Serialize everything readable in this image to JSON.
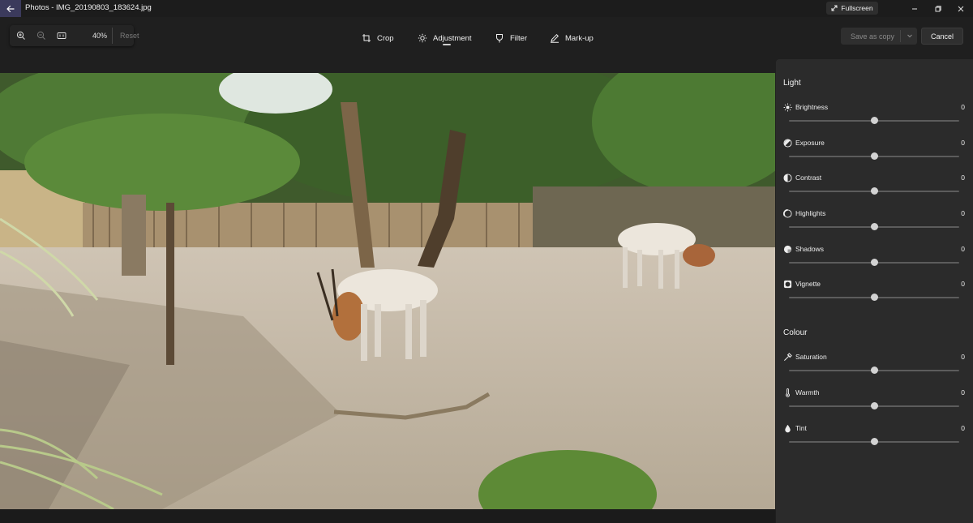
{
  "titlebar": {
    "app_title": "Photos - IMG_20190803_183624.jpg",
    "fullscreen_label": "Fullscreen"
  },
  "toolbar": {
    "zoom_level": "40%",
    "reset_label": "Reset",
    "tabs": [
      {
        "label": "Crop",
        "icon": "crop-icon"
      },
      {
        "label": "Adjustment",
        "icon": "sun-icon",
        "selected": true
      },
      {
        "label": "Filter",
        "icon": "filter-icon"
      },
      {
        "label": "Mark-up",
        "icon": "pen-icon"
      }
    ],
    "save_label": "Save as copy",
    "cancel_label": "Cancel"
  },
  "panel": {
    "light_title": "Light",
    "colour_title": "Colour",
    "light": [
      {
        "label": "Brightness",
        "value": "0",
        "icon": "brightness-icon",
        "level": 0.5
      },
      {
        "label": "Exposure",
        "value": "0",
        "icon": "exposure-icon",
        "level": 0.5
      },
      {
        "label": "Contrast",
        "value": "0",
        "icon": "contrast-icon",
        "level": 0.5
      },
      {
        "label": "Highlights",
        "value": "0",
        "icon": "highlights-icon",
        "level": 0.5
      },
      {
        "label": "Shadows",
        "value": "0",
        "icon": "shadows-icon",
        "level": 0.5
      },
      {
        "label": "Vignette",
        "value": "0",
        "icon": "vignette-icon",
        "level": 0.5
      }
    ],
    "colour": [
      {
        "label": "Saturation",
        "value": "0",
        "icon": "saturation-icon",
        "level": 0.5
      },
      {
        "label": "Warmth",
        "value": "0",
        "icon": "thermometer-icon",
        "level": 0.5
      },
      {
        "label": "Tint",
        "value": "0",
        "icon": "droplet-icon",
        "level": 0.5
      }
    ]
  },
  "colors": {
    "background": "#1f1f1f",
    "panel": "#2b2b2b",
    "back_button": "#3b3a5c"
  }
}
